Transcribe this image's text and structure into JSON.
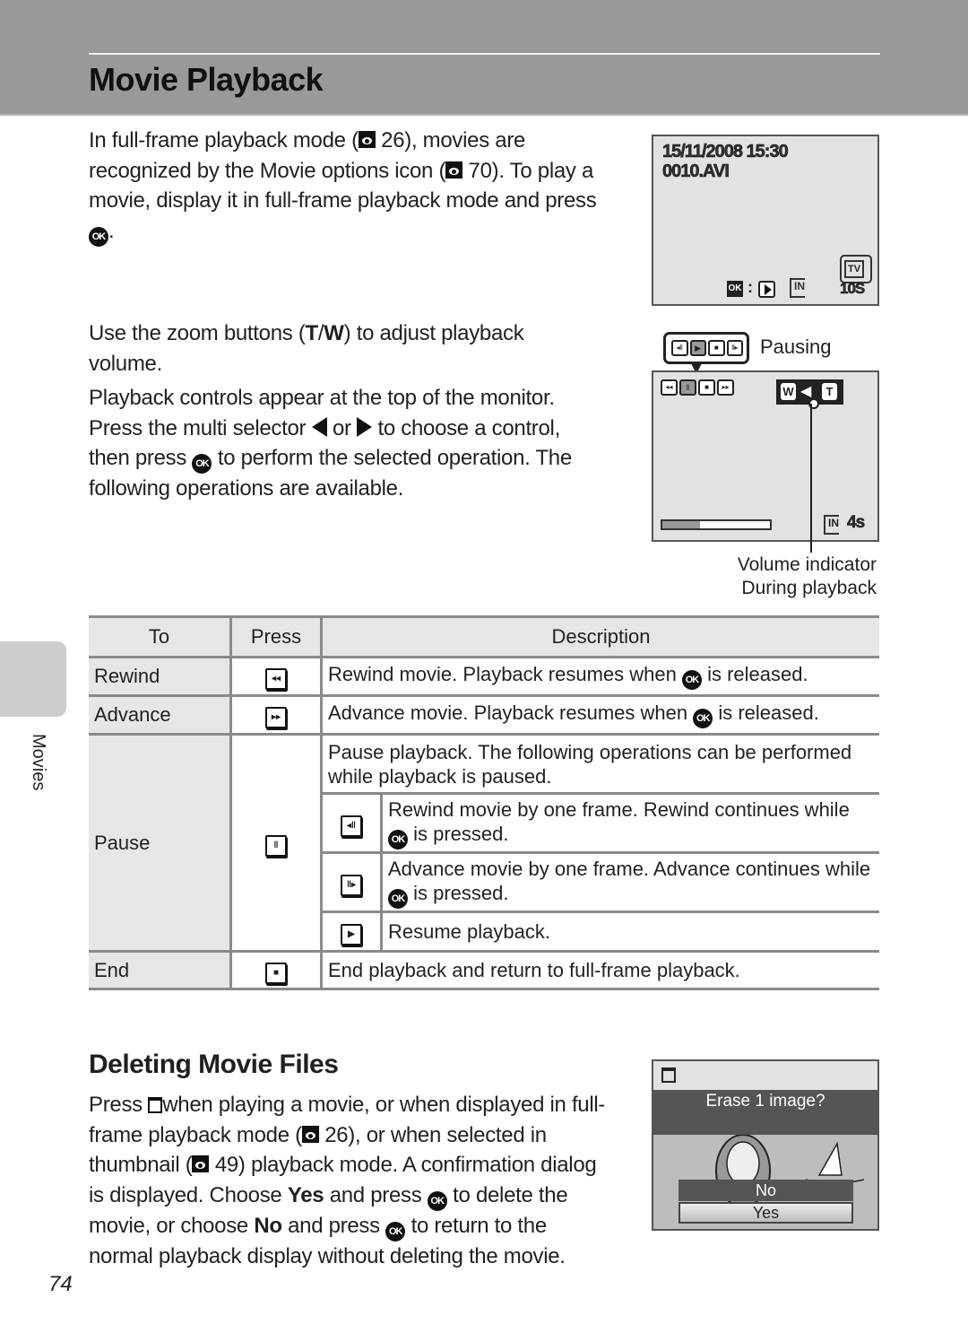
{
  "header": {
    "title": "Movie Playback"
  },
  "intro": {
    "line1_a": "In full-frame playback mode (",
    "line1_ref": "26",
    "line1_b": "), movies are",
    "line2_a": "recognized by the Movie options icon (",
    "line2_ref": "70",
    "line2_b": "). To play a",
    "line3": "movie, display it in full-frame playback mode and press",
    "line4": "."
  },
  "zoom_para": {
    "a": "Use the zoom buttons (",
    "t": "T",
    "slash": "/",
    "w": "W",
    "b": ") to adjust playback",
    "c": "volume."
  },
  "controls_para": {
    "line1": "Playback controls appear at the top of the monitor.",
    "line2_a": "Press the multi selector",
    "line2_or": "or",
    "line2_b": "to choose a control,",
    "line3_a": "then press",
    "line3_b": "to perform the selected operation. The",
    "line4": "following operations are available."
  },
  "ok_label": "OK",
  "screen1": {
    "datetime": "15/11/2008 15:30",
    "filename": "0010.AVI",
    "ok_label": "OK",
    "colon": ":",
    "memory": "IN",
    "duration": "10S",
    "tv_label": "TV"
  },
  "screen2": {
    "pausing_label": "Pausing",
    "w_label": "W",
    "t_label": "T",
    "memory": "IN",
    "remaining": "4s",
    "progress": 0.35,
    "callout_line1": "Volume indicator",
    "callout_line2": "During playback"
  },
  "table": {
    "headers": [
      "To",
      "Press",
      "Description"
    ],
    "rows": [
      {
        "to": "Rewind",
        "icon": "rewind",
        "desc_a": "Rewind movie. Playback resumes when",
        "desc_b": "is released."
      },
      {
        "to": "Advance",
        "icon": "advance",
        "desc_a": "Advance movie. Playback resumes when",
        "desc_b": "is released."
      },
      {
        "to": "Pause",
        "icon": "pause",
        "desc": "Pause playback. The following operations can be performed while playback is paused.",
        "sub": [
          {
            "icon": "frame-rewind",
            "desc_a": "Rewind movie by one frame. Rewind continues while",
            "desc_b": "is pressed."
          },
          {
            "icon": "frame-advance",
            "desc_a": "Advance movie by one frame. Advance continues while",
            "desc_b": "is pressed."
          },
          {
            "icon": "play",
            "desc": "Resume playback."
          }
        ]
      },
      {
        "to": "End",
        "icon": "stop",
        "desc": "End playback and return to full-frame playback."
      }
    ]
  },
  "side_tab": {
    "label": "Movies"
  },
  "delete": {
    "title": "Deleting Movie Files",
    "l1_a": "Press",
    "l1_b": "when playing a movie, or when displayed in full-",
    "l2_a": "frame playback mode (",
    "l2_ref": "26",
    "l2_b": "), or when selected in",
    "l3_a": "thumbnail (",
    "l3_ref": "49",
    "l3_b": ") playback mode. A confirmation dialog",
    "l4_a": "is displayed. Choose",
    "l4_yes": "Yes",
    "l4_b": "and press",
    "l4_c": "to delete the",
    "l5_a": "movie, or choose",
    "l5_no": "No",
    "l5_b": "and press",
    "l5_c": "to return to the",
    "l6": "normal playback display without deleting the movie."
  },
  "dialog": {
    "prompt": "Erase 1 image?",
    "options": [
      "No",
      "Yes"
    ],
    "selected": "Yes"
  },
  "page_number": "74"
}
